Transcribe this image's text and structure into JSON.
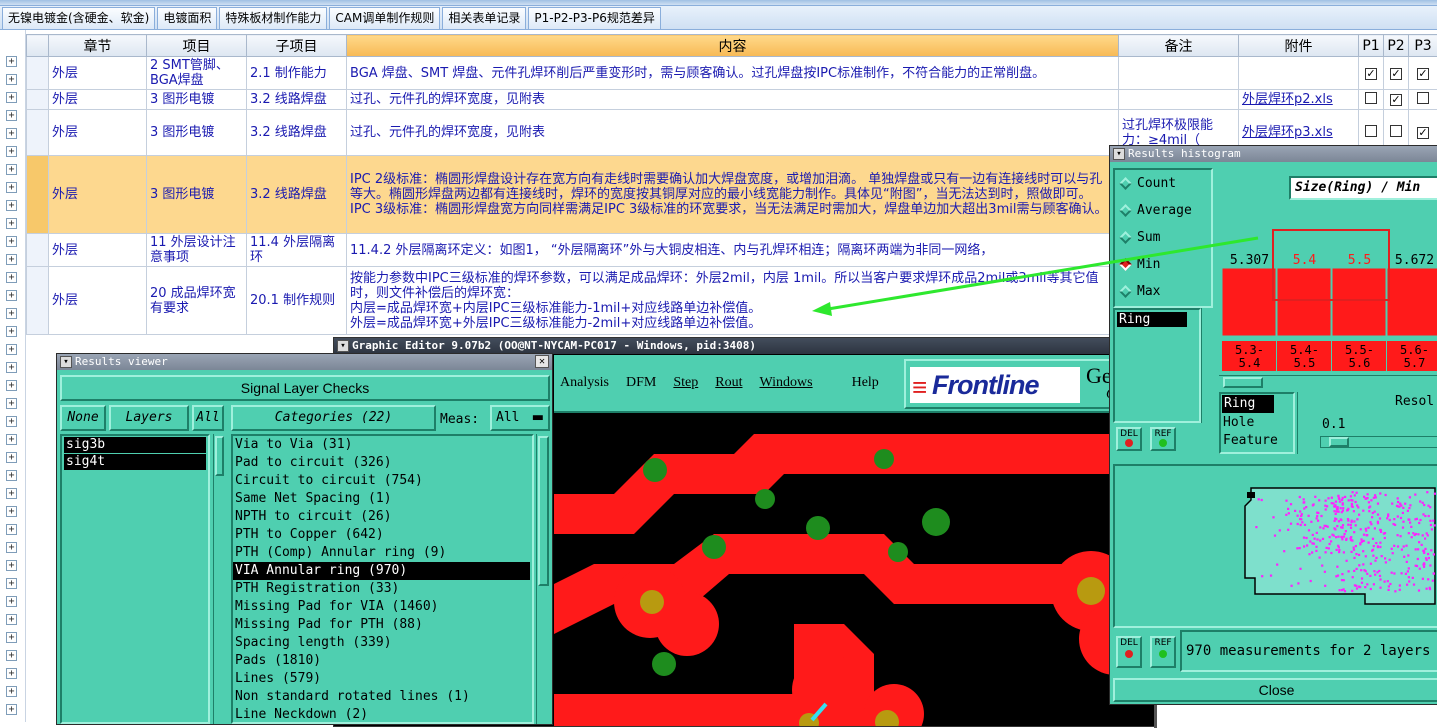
{
  "tabs": [
    "无镍电镀金(含硬金、软金)",
    "电镀面积",
    "特殊板材制作能力",
    "CAM调单制作规则",
    "相关表单记录",
    "P1-P2-P3-P6规范差异"
  ],
  "grid": {
    "headers": [
      "章节",
      "项目",
      "子项目",
      "内容",
      "备注",
      "附件",
      "P1",
      "P2",
      "P3"
    ],
    "rows": [
      {
        "c1": "外层",
        "c2": "2 SMT管脚、BGA焊盘",
        "c3": "2.1 制作能力",
        "c4": "BGA 焊盘、SMT 焊盘、元件孔焊环削后严重变形时，需与顾客确认。过孔焊盘按IPC标准制作，不符合能力的正常削盘。",
        "c5": "",
        "c6": "",
        "p": [
          "✓",
          "✓",
          "✓"
        ]
      },
      {
        "c1": "外层",
        "c2": "3 图形电镀",
        "c3": "3.2 线路焊盘",
        "c4": "过孔、元件孔的焊环宽度，见附表",
        "c5": "",
        "c6": "外层焊环p2.xls",
        "p": [
          "",
          "✓",
          ""
        ]
      },
      {
        "c1": "外层",
        "c2": "3 图形电镀",
        "c3": "3.2 线路焊盘",
        "c4": "过孔、元件孔的焊环宽度，见附表",
        "c5": "过孔焊环极限能力：≥4mil（",
        "c6": "外层焊环p3.xls",
        "p": [
          "",
          "",
          "✓"
        ]
      },
      {
        "c1": "外层",
        "c2": "3 图形电镀",
        "c3": "3.2 线路焊盘",
        "c4": "IPC 2级标准：椭圆形焊盘设计存在宽方向有走线时需要确认加大焊盘宽度，或增加泪滴。 单独焊盘或只有一边有连接线时可以与孔等大。椭圆形焊盘两边都有连接线时，焊环的宽度按其铜厚对应的最小线宽能力制作。具体见“附图”，当无法达到时，照做即可。\nIPC 3级标准：椭圆形焊盘宽方向同样需满足IPC 3级标准的环宽要求，当无法满足时需加大，焊盘单边加大超出3mil需与顾客确认。",
        "c5": "",
        "c6": "",
        "p": [
          "",
          "",
          ""
        ]
      },
      {
        "c1": "外层",
        "c2": "11 外层设计注意事项",
        "c3": "11.4 外层隔离环",
        "c4": "11.4.2 外层隔离环定义：如图1， “外层隔离环”外与大铜皮相连、内与孔焊环相连；隔离环两端为非同一网络，",
        "c5": "",
        "c6": "",
        "p": [
          "",
          "",
          ""
        ]
      },
      {
        "c1": "外层",
        "c2": "20 成品焊环宽有要求",
        "c3": "20.1 制作规则",
        "c4": "按能力参数中IPC三级标准的焊环参数，可以满足成品焊环：外层2mil，内层 1mil。所以当客户要求焊环成品2mil或3mil等其它值时，则文件补偿后的焊环宽：\n内层=成品焊环宽+内层IPC三级标准能力-1mil+对应线路单边补偿值。\n外层=成品焊环宽+外层IPC三级标准能力-2mil+对应线路单边补偿值。",
        "c5": "",
        "c6": "",
        "p": [
          "",
          "",
          ""
        ]
      }
    ]
  },
  "viewer": {
    "title": "Results viewer",
    "section": "Signal Layer Checks",
    "none": "None",
    "layers": "Layers",
    "all": "All",
    "categories_btn": "Categories (22)",
    "meas_label": "Meas:",
    "meas_value": "All",
    "layer_items": [
      "sig3b",
      "sig4t"
    ],
    "categories": [
      "Via to Via (31)",
      "Pad to circuit (326)",
      "Circuit to circuit (754)",
      "Same Net Spacing (1)",
      "NPTH to circuit (26)",
      "PTH to Copper (642)",
      "PTH (Comp) Annular ring (9)",
      "VIA Annular ring (970)",
      "PTH Registration (33)",
      "Missing Pad for VIA (1460)",
      "Missing Pad for PTH (88)",
      "Spacing length (339)",
      "Pads (1810)",
      "Lines (579)",
      "Non standard rotated lines (1)",
      "Line Neckdown (2)"
    ]
  },
  "editor": {
    "title": "Graphic Editor 9.07b2 (OO@NT-NYCAM-PC017 - Windows, pid:3408)",
    "menu": [
      "Analysis",
      "DFM",
      "Step",
      "Rout",
      "Windows",
      "Help"
    ],
    "logo": "Frontline",
    "logo_suffix": "Gen",
    "logo_suffix2": "G"
  },
  "histogram": {
    "title": "Results histogram",
    "options": [
      "Count",
      "Average",
      "Sum",
      "Min",
      "Max"
    ],
    "selected_option": "Min",
    "field_value": "Ring",
    "header": "Size(Ring) / Min",
    "top_values": [
      "5.307",
      "5.4",
      "5.5",
      "5.672"
    ],
    "ranges": [
      "5.3-\n5.4",
      "5.4-\n5.5",
      "5.5-\n5.6",
      "5.6-\n5.7"
    ],
    "list": [
      "Ring",
      "Hole",
      "Feature"
    ],
    "resolution_label": "Resol",
    "resolution_value": "0.1",
    "del": "DEL",
    "ref": "REF",
    "status": "970 measurements for 2 layers",
    "close": "Close"
  },
  "colors": {
    "accent": "#2ee82e",
    "teal": "#4fcfb0",
    "pcb_red": "#ff1a1a"
  }
}
